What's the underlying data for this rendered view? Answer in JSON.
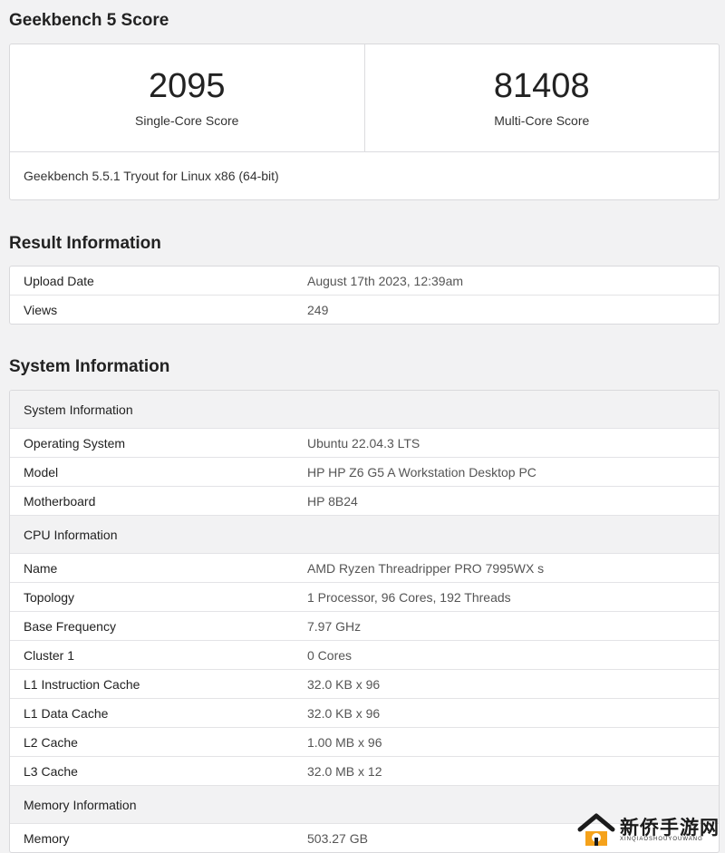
{
  "score_section": {
    "title": "Geekbench 5 Score",
    "single_core": {
      "value": "2095",
      "label": "Single-Core Score"
    },
    "multi_core": {
      "value": "81408",
      "label": "Multi-Core Score"
    },
    "footer": "Geekbench 5.5.1 Tryout for Linux x86 (64-bit)"
  },
  "result_section": {
    "title": "Result Information",
    "rows": [
      {
        "key": "Upload Date",
        "value": "August 17th 2023, 12:39am"
      },
      {
        "key": "Views",
        "value": "249"
      }
    ]
  },
  "system_section": {
    "title": "System Information",
    "groups": [
      {
        "header": "System Information",
        "rows": [
          {
            "key": "Operating System",
            "value": "Ubuntu 22.04.3 LTS"
          },
          {
            "key": "Model",
            "value": "HP HP Z6 G5 A Workstation Desktop PC"
          },
          {
            "key": "Motherboard",
            "value": "HP 8B24"
          }
        ]
      },
      {
        "header": "CPU Information",
        "rows": [
          {
            "key": "Name",
            "value": "AMD Ryzen Threadripper PRO 7995WX s"
          },
          {
            "key": "Topology",
            "value": "1 Processor, 96 Cores, 192 Threads"
          },
          {
            "key": "Base Frequency",
            "value": "7.97 GHz"
          },
          {
            "key": "Cluster 1",
            "value": "0 Cores"
          },
          {
            "key": "L1 Instruction Cache",
            "value": "32.0 KB x 96"
          },
          {
            "key": "L1 Data Cache",
            "value": "32.0 KB x 96"
          },
          {
            "key": "L2 Cache",
            "value": "1.00 MB x 96"
          },
          {
            "key": "L3 Cache",
            "value": "32.0 MB x 12"
          }
        ]
      },
      {
        "header": "Memory Information",
        "rows": [
          {
            "key": "Memory",
            "value": "503.27 GB"
          }
        ]
      }
    ]
  },
  "watermark": {
    "text": "新侨手游网",
    "subtext": "XINQIAOSHOUYOUWANG",
    "icon": "house-logo-icon",
    "accent_color": "#f5a21b"
  }
}
